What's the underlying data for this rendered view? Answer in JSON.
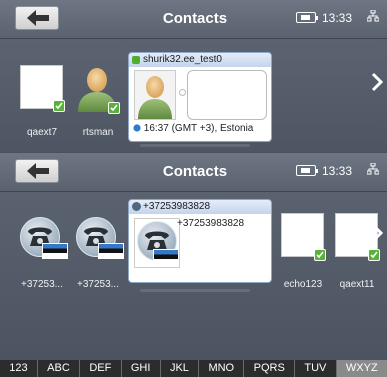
{
  "top": {
    "title": "Contacts",
    "time": "13:33",
    "contacts": [
      {
        "label": "qaext7"
      },
      {
        "label": "rtsman"
      }
    ],
    "card": {
      "name": "shurik32.ee_test0",
      "location": "16:37 (GMT +3), Estonia"
    }
  },
  "bottom": {
    "title": "Contacts",
    "time": "13:33",
    "contacts": [
      {
        "label": "+37253..."
      },
      {
        "label": "+37253..."
      },
      {
        "label": "echo123"
      },
      {
        "label": "qaext11"
      }
    ],
    "card": {
      "header": "+37253983828",
      "number": "+37253983828"
    }
  },
  "keyboard": {
    "keys": [
      "123",
      "ABC",
      "DEF",
      "GHI",
      "JKL",
      "MNO",
      "PQRS",
      "TUV",
      "WXYZ"
    ],
    "active": "WXYZ"
  },
  "colors": {
    "status_online": "#58b23a",
    "card_header": "#c3d4ec"
  }
}
